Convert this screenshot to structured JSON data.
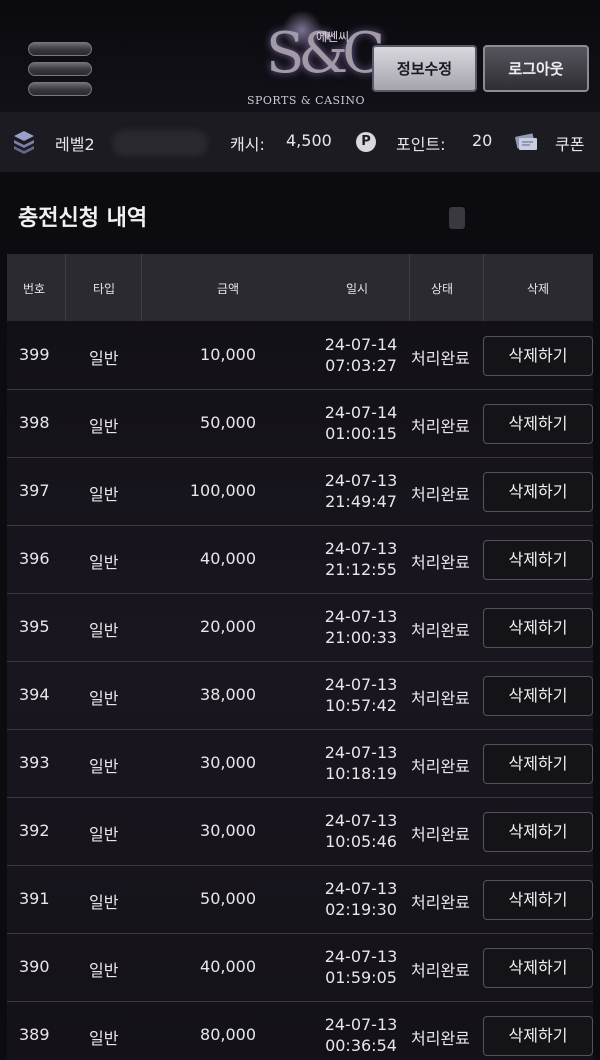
{
  "header": {
    "logo_korean": "에쎈씨",
    "logo_mark": "S&C",
    "logo_sub": "SPORTS & CASINO",
    "edit_label": "정보수정",
    "logout_label": "로그아웃"
  },
  "infobar": {
    "level": "레벨2",
    "cash_label": "캐시:",
    "cash_value": "4,500",
    "point_icon": "P",
    "point_label": "포인트:",
    "point_value": "20",
    "coupon_label": "쿠폰"
  },
  "section_title": "충전신청 내역",
  "table": {
    "headers": {
      "num": "번호",
      "type": "타입",
      "amount": "금액",
      "datetime": "일시",
      "status": "상태",
      "delete": "삭제"
    },
    "rows": [
      {
        "num": "399",
        "type": "일반",
        "amount": "10,000",
        "date": "24-07-14",
        "time": "07:03:27",
        "status": "처리완료",
        "action": "삭제하기"
      },
      {
        "num": "398",
        "type": "일반",
        "amount": "50,000",
        "date": "24-07-14",
        "time": "01:00:15",
        "status": "처리완료",
        "action": "삭제하기"
      },
      {
        "num": "397",
        "type": "일반",
        "amount": "100,000",
        "date": "24-07-13",
        "time": "21:49:47",
        "status": "처리완료",
        "action": "삭제하기"
      },
      {
        "num": "396",
        "type": "일반",
        "amount": "40,000",
        "date": "24-07-13",
        "time": "21:12:55",
        "status": "처리완료",
        "action": "삭제하기"
      },
      {
        "num": "395",
        "type": "일반",
        "amount": "20,000",
        "date": "24-07-13",
        "time": "21:00:33",
        "status": "처리완료",
        "action": "삭제하기"
      },
      {
        "num": "394",
        "type": "일반",
        "amount": "38,000",
        "date": "24-07-13",
        "time": "10:57:42",
        "status": "처리완료",
        "action": "삭제하기"
      },
      {
        "num": "393",
        "type": "일반",
        "amount": "30,000",
        "date": "24-07-13",
        "time": "10:18:19",
        "status": "처리완료",
        "action": "삭제하기"
      },
      {
        "num": "392",
        "type": "일반",
        "amount": "30,000",
        "date": "24-07-13",
        "time": "10:05:46",
        "status": "처리완료",
        "action": "삭제하기"
      },
      {
        "num": "391",
        "type": "일반",
        "amount": "50,000",
        "date": "24-07-13",
        "time": "02:19:30",
        "status": "처리완료",
        "action": "삭제하기"
      },
      {
        "num": "390",
        "type": "일반",
        "amount": "40,000",
        "date": "24-07-13",
        "time": "01:59:05",
        "status": "처리완료",
        "action": "삭제하기"
      },
      {
        "num": "389",
        "type": "일반",
        "amount": "80,000",
        "date": "24-07-13",
        "time": "00:36:54",
        "status": "처리완료",
        "action": "삭제하기"
      }
    ]
  }
}
